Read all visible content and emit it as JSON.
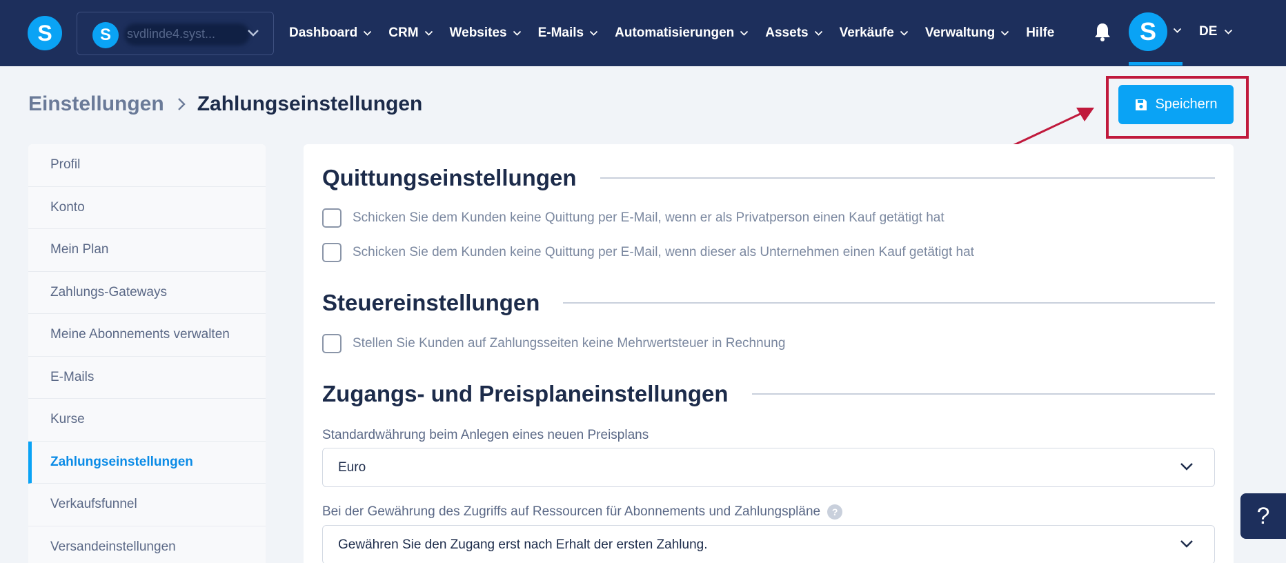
{
  "topbar": {
    "logo_letter": "S",
    "site": {
      "avatar_letter": "S",
      "name": "svdlinde4.syst..."
    },
    "nav": [
      {
        "label": "Dashboard",
        "has_dropdown": true
      },
      {
        "label": "CRM",
        "has_dropdown": true
      },
      {
        "label": "Websites",
        "has_dropdown": true
      },
      {
        "label": "E-Mails",
        "has_dropdown": true
      },
      {
        "label": "Automatisierungen",
        "has_dropdown": true
      },
      {
        "label": "Assets",
        "has_dropdown": true
      },
      {
        "label": "Verkäufe",
        "has_dropdown": true
      },
      {
        "label": "Verwaltung",
        "has_dropdown": true
      },
      {
        "label": "Hilfe",
        "has_dropdown": false
      }
    ],
    "user_avatar_letter": "S",
    "language": "DE"
  },
  "breadcrumb": {
    "parent": "Einstellungen",
    "current": "Zahlungseinstellungen"
  },
  "save_button": {
    "label": "Speichern"
  },
  "sidebar": {
    "items": [
      {
        "label": "Profil",
        "active": false
      },
      {
        "label": "Konto",
        "active": false
      },
      {
        "label": "Mein Plan",
        "active": false
      },
      {
        "label": "Zahlungs-Gateways",
        "active": false
      },
      {
        "label": "Meine Abonnements verwalten",
        "active": false
      },
      {
        "label": "E-Mails",
        "active": false
      },
      {
        "label": "Kurse",
        "active": false
      },
      {
        "label": "Zahlungseinstellungen",
        "active": true
      },
      {
        "label": "Verkaufsfunnel",
        "active": false
      },
      {
        "label": "Versandeinstellungen",
        "active": false
      }
    ]
  },
  "receipts": {
    "title": "Quittungseinstellungen",
    "options": [
      {
        "label": "Schicken Sie dem Kunden keine Quittung per E-Mail, wenn er als Privatperson einen Kauf getätigt hat",
        "checked": false
      },
      {
        "label": "Schicken Sie dem Kunden keine Quittung per E-Mail, wenn dieser als Unternehmen einen Kauf getätigt hat",
        "checked": false
      }
    ]
  },
  "tax": {
    "title": "Steuereinstellungen",
    "options": [
      {
        "label": "Stellen Sie Kunden auf Zahlungsseiten keine Mehrwertsteuer in Rechnung",
        "checked": false
      }
    ]
  },
  "access": {
    "title": "Zugangs- und Preisplaneinstellungen",
    "currency_label": "Standardwährung beim Anlegen eines neuen Preisplans",
    "currency_value": "Euro",
    "grant_label": "Bei der Gewährung des Zugriffs auf Ressourcen für Abonnements und Zahlungspläne",
    "grant_help": "?",
    "grant_value": "Gewähren Sie den Zugang erst nach Erhalt der ersten Zahlung."
  },
  "help_widget": {
    "label": "?"
  },
  "colors": {
    "topbar": "#1d2f5c",
    "accent": "#0aa3f5",
    "highlight": "#c0193c",
    "page_bg": "#f1f4f8"
  }
}
